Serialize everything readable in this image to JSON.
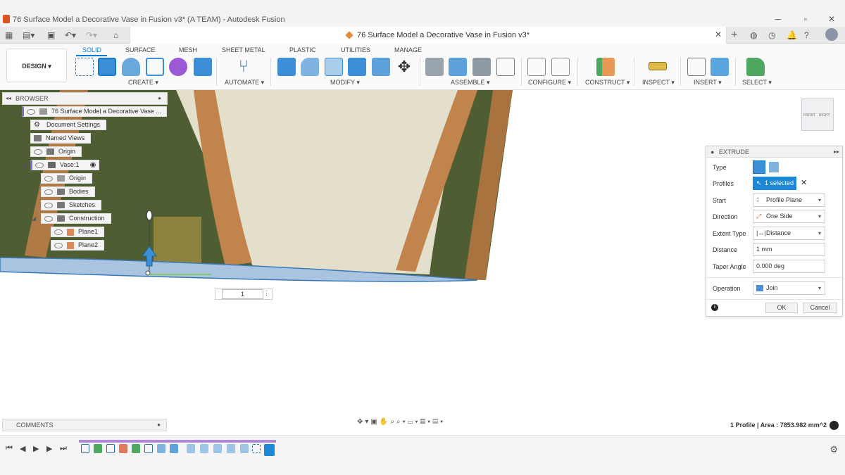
{
  "window": {
    "title": "76 Surface Model a Decorative Vase in Fusion v3* (A TEAM) - Autodesk Fusion"
  },
  "tabbar": {
    "document_title": "76 Surface Model a Decorative Vase in Fusion v3*"
  },
  "toolbar": {
    "workspace": "DESIGN ▾",
    "tabs": [
      "SOLID",
      "SURFACE",
      "MESH",
      "SHEET METAL",
      "PLASTIC",
      "UTILITIES",
      "MANAGE"
    ],
    "active_tab": "SOLID",
    "groups": [
      "CREATE ▾",
      "AUTOMATE ▾",
      "MODIFY ▾",
      "ASSEMBLE ▾",
      "CONFIGURE ▾",
      "CONSTRUCT ▾",
      "INSPECT ▾",
      "INSERT ▾",
      "SELECT ▾"
    ]
  },
  "browser": {
    "title": "BROWSER",
    "items": [
      {
        "label": "76 Surface Model a Decorative Vase ..."
      },
      {
        "label": "Document Settings"
      },
      {
        "label": "Named Views"
      },
      {
        "label": "Origin"
      },
      {
        "label": "Vase:1"
      },
      {
        "label": "Origin"
      },
      {
        "label": "Bodies"
      },
      {
        "label": "Sketches"
      },
      {
        "label": "Construction"
      },
      {
        "label": "Plane1"
      },
      {
        "label": "Plane2"
      }
    ]
  },
  "viewcube": {
    "front": "FRONT",
    "right": "RIGHT"
  },
  "viewport": {
    "distance_input": "1"
  },
  "extrude": {
    "title": "EXTRUDE",
    "type_label": "Type",
    "profiles_label": "Profiles",
    "profiles_value": "1 selected",
    "start_label": "Start",
    "start_value": "Profile Plane",
    "direction_label": "Direction",
    "direction_value": "One Side",
    "extent_label": "Extent Type",
    "extent_value": "Distance",
    "distance_label": "Distance",
    "distance_value": "1 mm",
    "taper_label": "Taper Angle",
    "taper_value": "0.000 deg",
    "operation_label": "Operation",
    "operation_value": "Join",
    "ok_label": "OK",
    "cancel_label": "Cancel"
  },
  "comments": {
    "title": "COMMENTS"
  },
  "status": {
    "text": "1 Profile | Area : 7853.982 mm^2"
  },
  "colors": {
    "accent": "#0d7bd0",
    "timeline": "#b089d8"
  }
}
